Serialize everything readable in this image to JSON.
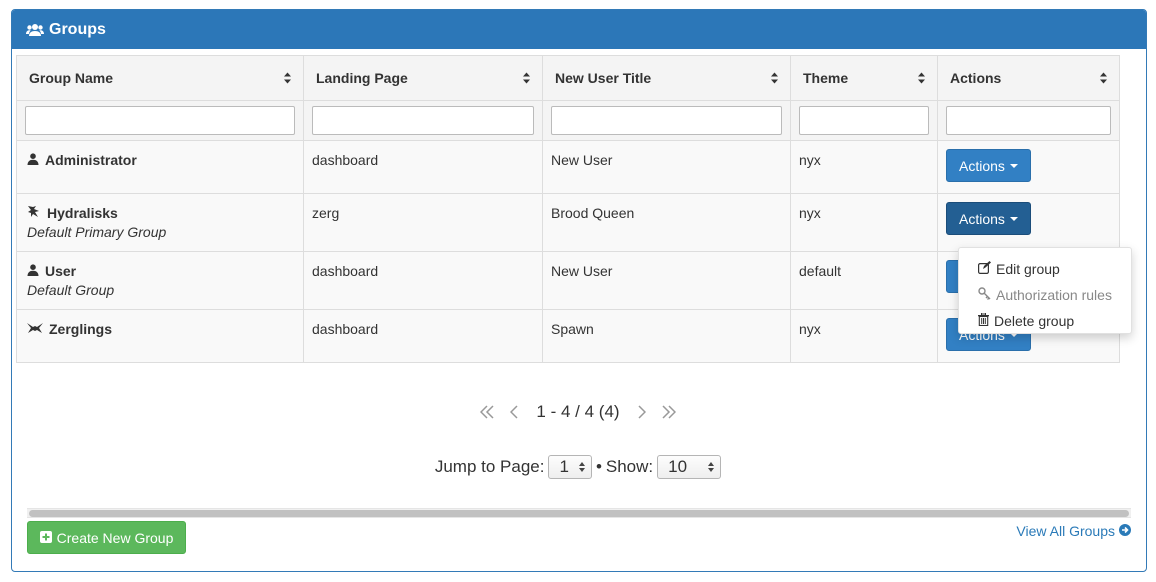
{
  "panel": {
    "title": "Groups",
    "icon": "users-icon"
  },
  "table": {
    "columns": [
      "Group Name",
      "Landing Page",
      "New User Title",
      "Theme",
      "Actions"
    ],
    "rows": [
      {
        "icon": "user-icon",
        "name": "Administrator",
        "subtitle": "",
        "landing_page": "dashboard",
        "new_user_title": "New User",
        "theme": "nyx",
        "action_label": "Actions"
      },
      {
        "icon": "hydralisk-icon",
        "name": "Hydralisks",
        "subtitle": "Default Primary Group",
        "landing_page": "zerg",
        "new_user_title": "Brood Queen",
        "theme": "nyx",
        "action_label": "Actions"
      },
      {
        "icon": "user-icon",
        "name": "User",
        "subtitle": "Default Group",
        "landing_page": "dashboard",
        "new_user_title": "New User",
        "theme": "default",
        "action_label": ""
      },
      {
        "icon": "zergling-icon",
        "name": "Zerglings",
        "subtitle": "",
        "landing_page": "dashboard",
        "new_user_title": "Spawn",
        "theme": "nyx",
        "action_label": "Actions"
      }
    ]
  },
  "dropdown": {
    "items": [
      {
        "label": "Edit group",
        "icon": "edit-icon"
      },
      {
        "label": "Authorization rules",
        "icon": "key-icon"
      },
      {
        "label": "Delete group",
        "icon": "trash-icon"
      }
    ]
  },
  "pager": {
    "text": "1 - 4 / 4 (4)",
    "jump_label": "Jump to Page:",
    "jump_value": "1",
    "separator": "•",
    "show_label": "Show:",
    "show_value": "10"
  },
  "footer": {
    "create_label": "Create New Group",
    "view_all_label": "View All Groups"
  },
  "colors": {
    "heading": "#2c77b8",
    "primary_button": "#3280c4",
    "success_button": "#5cb85c",
    "link": "#2a7ab8"
  }
}
